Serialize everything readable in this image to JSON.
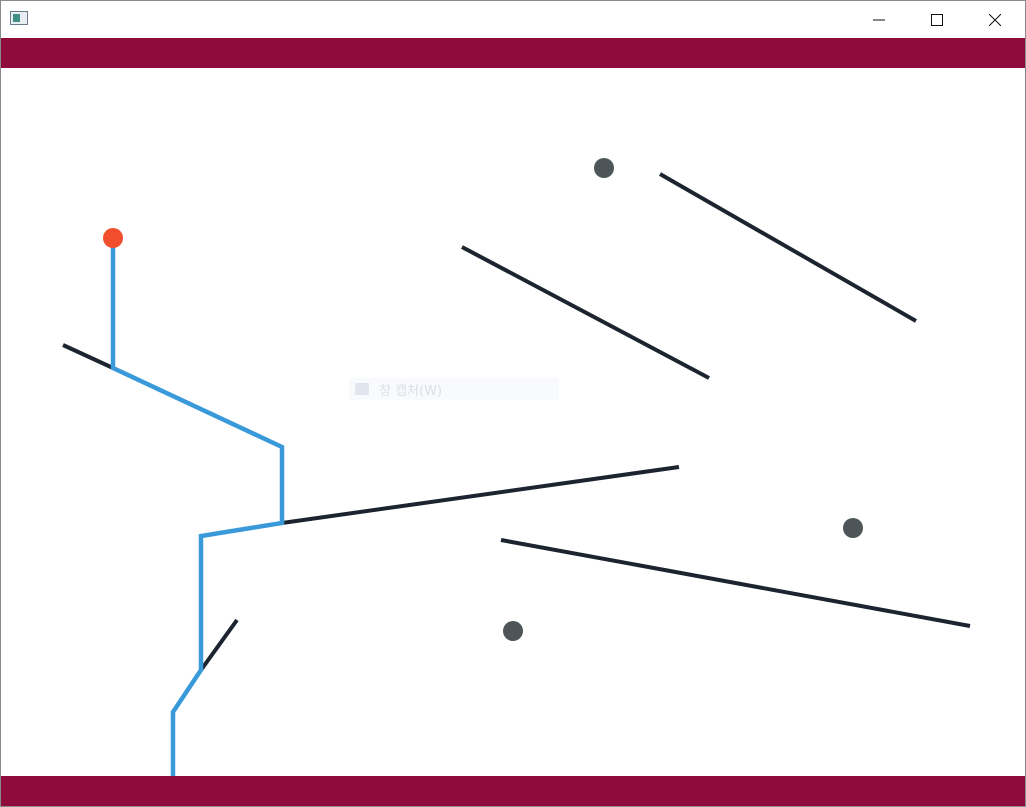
{
  "window": {
    "icon": "app-window-icon",
    "controls": [
      "minimize-icon",
      "maximize-icon",
      "close-icon"
    ]
  },
  "colors": {
    "band": "#8e0b3c",
    "wall": "#1c2430",
    "path": "#3a9ad9",
    "ball": "#f04e2c",
    "target": "#4d5558"
  },
  "ghost_tooltip": {
    "label": "창 캡처(W)"
  }
}
